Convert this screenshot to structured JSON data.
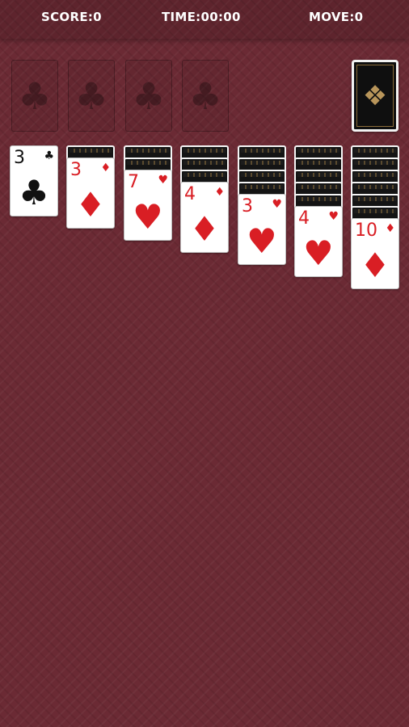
{
  "stats": {
    "score": "SCORE:0",
    "time": "TIME:00:00",
    "move": "MOVE:0"
  },
  "foundations": [
    {
      "icon": "club-icon",
      "glyph": "♣"
    },
    {
      "icon": "club-icon",
      "glyph": "♣"
    },
    {
      "icon": "club-icon",
      "glyph": "♣"
    },
    {
      "icon": "club-icon",
      "glyph": "♣"
    }
  ],
  "stock": {
    "icon": "card-back-ornament-icon",
    "glyph": "❖"
  },
  "tableau": [
    {
      "hidden": 0,
      "rank": "3",
      "suit": "♣",
      "color": "black"
    },
    {
      "hidden": 1,
      "rank": "3",
      "suit": "♦",
      "color": "red"
    },
    {
      "hidden": 2,
      "rank": "7",
      "suit": "♥",
      "color": "red"
    },
    {
      "hidden": 3,
      "rank": "4",
      "suit": "♦",
      "color": "red"
    },
    {
      "hidden": 4,
      "rank": "3",
      "suit": "♥",
      "color": "red"
    },
    {
      "hidden": 5,
      "rank": "4",
      "suit": "♥",
      "color": "red"
    },
    {
      "hidden": 6,
      "rank": "10",
      "suit": "♦",
      "color": "red"
    }
  ],
  "colors": {
    "felt": "#6b2a34",
    "red_suit": "#d91e24",
    "black_suit": "#111111"
  }
}
